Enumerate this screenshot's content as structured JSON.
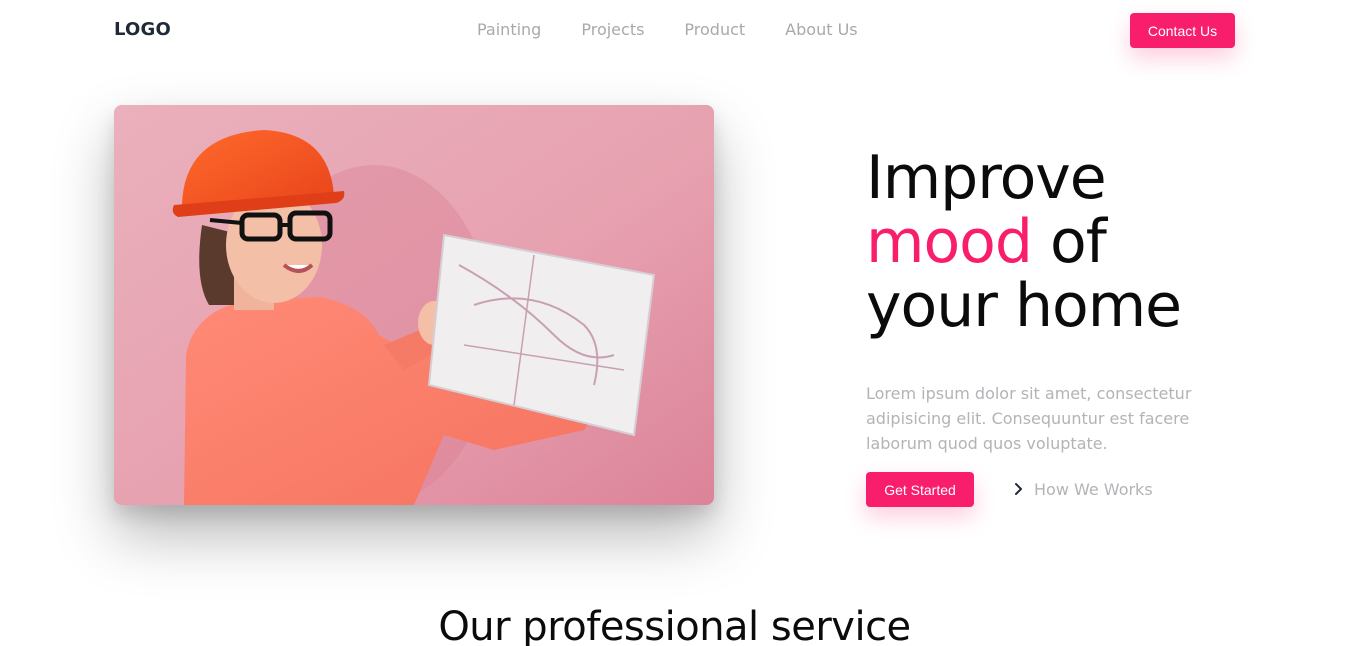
{
  "header": {
    "logo": "LOGO",
    "nav": [
      "Painting",
      "Projects",
      "Product",
      "About Us"
    ],
    "contact_label": "Contact Us"
  },
  "hero": {
    "headline_line1": "Improve",
    "headline_accent": "mood",
    "headline_line2_rest": " of",
    "headline_line3": "your home",
    "description": "Lorem ipsum dolor sit amet, consectetur adipisicing elit. Consequuntur est facere laborum quod quos voluptate.",
    "primary_cta": "Get Started",
    "secondary_cta": "How We Works",
    "image_alt": "Woman in hard hat holding blueprint"
  },
  "services": {
    "title": "Our professional service"
  },
  "colors": {
    "accent": "#f81e6c",
    "muted_text": "#b3b3b8",
    "nav_text": "#a9a9ad",
    "heading": "#0b0b0b"
  },
  "icons": {
    "secondary_cta_icon": "chevron-right-icon"
  }
}
